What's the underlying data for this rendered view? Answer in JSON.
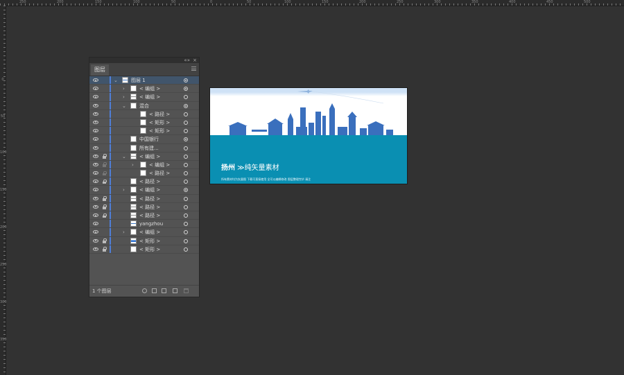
{
  "ruler": {
    "top_labels": [
      "250",
      "200",
      "150",
      "100",
      "50",
      "0",
      "50",
      "100",
      "150",
      "200",
      "250",
      "300",
      "350",
      "400",
      "450",
      "500"
    ],
    "left_labels": [
      "0",
      "50",
      "100",
      "150",
      "200",
      "250",
      "300",
      "350"
    ]
  },
  "panel": {
    "tab": "图层",
    "collapse_icon": "double-arrow-icon",
    "close_icon": "close-icon",
    "footer": "1 个图层",
    "rows": [
      {
        "label": "图层 1",
        "selected": true
      },
      {
        "label": "< 编组 >"
      },
      {
        "label": "< 编组 >"
      },
      {
        "label": "混合"
      },
      {
        "label": "< 路径 >"
      },
      {
        "label": "< 矩形 >"
      },
      {
        "label": "< 矩形 >"
      },
      {
        "label": "中国银行"
      },
      {
        "label": "所有建..."
      },
      {
        "label": "< 编组 >"
      },
      {
        "label": "< 编组 >"
      },
      {
        "label": "< 路径 >"
      },
      {
        "label": "< 路径 >"
      },
      {
        "label": "< 编组 >"
      },
      {
        "label": "< 路径 >"
      },
      {
        "label": "< 路径 >"
      },
      {
        "label": "< 路径 >"
      },
      {
        "label": "yangzhou"
      },
      {
        "label": "< 编组 >"
      },
      {
        "label": "< 矩形 >"
      },
      {
        "label": "< 矩形 >"
      }
    ]
  },
  "artboard": {
    "title_bold": "扬州",
    "title_rest": " ≫纯矢量素材",
    "caption": "所有素材均为矢量图 下载可直接使用 全可以编辑修改 图层整理完毕 请注"
  },
  "colors": {
    "layer_color": "#4f7fd8",
    "sea": "#0a8fb2",
    "skyline": "#3a6fbd",
    "selected_row": "#41556b"
  }
}
